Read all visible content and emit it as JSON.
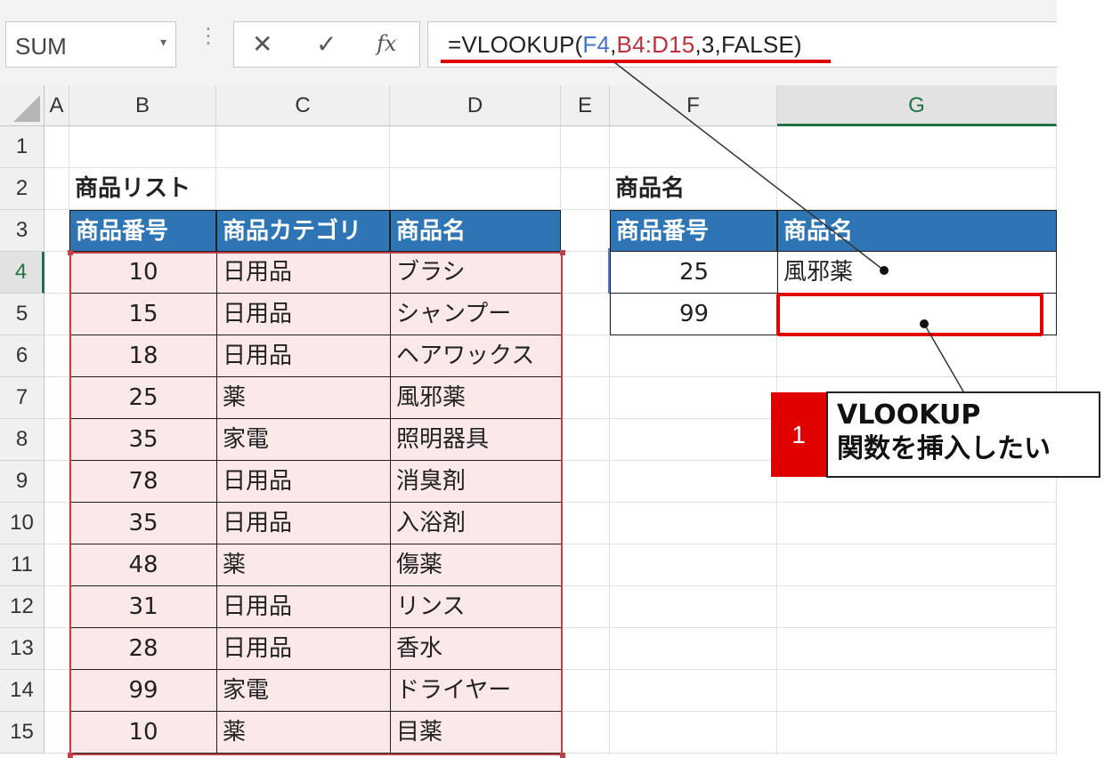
{
  "formula_bar": {
    "name_box": "SUM",
    "name_box_arrow": "▾",
    "separator": "⋮",
    "cancel_icon": "✕",
    "enter_icon": "✓",
    "fx_label": "fx",
    "formula": {
      "prefix": "=VLOOKUP(",
      "ref1": "F4",
      "comma1": ",",
      "ref2": "B4:D15",
      "suffix": ",3,FALSE)"
    },
    "colors": {
      "ref1": "#4472c4",
      "ref2": "#c0303a"
    }
  },
  "columns": [
    "A",
    "B",
    "C",
    "D",
    "E",
    "F",
    "G"
  ],
  "selected_column": "G",
  "rows": [
    "1",
    "2",
    "3",
    "4",
    "5",
    "6",
    "7",
    "8",
    "9",
    "10",
    "11",
    "12",
    "13",
    "14",
    "15"
  ],
  "selected_row": "4",
  "product_list": {
    "title": "商品リスト",
    "headers": [
      "商品番号",
      "商品カテゴリ",
      "商品名"
    ],
    "rows": [
      [
        "10",
        "日用品",
        "ブラシ"
      ],
      [
        "15",
        "日用品",
        "シャンプー"
      ],
      [
        "18",
        "日用品",
        "ヘアワックス"
      ],
      [
        "25",
        "薬",
        "風邪薬"
      ],
      [
        "35",
        "家電",
        "照明器具"
      ],
      [
        "78",
        "日用品",
        "消臭剤"
      ],
      [
        "35",
        "日用品",
        "入浴剤"
      ],
      [
        "48",
        "薬",
        "傷薬"
      ],
      [
        "31",
        "日用品",
        "リンス"
      ],
      [
        "28",
        "日用品",
        "香水"
      ],
      [
        "99",
        "家電",
        "ドライヤー"
      ],
      [
        "10",
        "薬",
        "目薬"
      ]
    ]
  },
  "lookup_table": {
    "title": "商品名",
    "headers": [
      "商品番号",
      "商品名"
    ],
    "rows": [
      [
        "25",
        "風邪薬"
      ],
      [
        "99",
        ""
      ]
    ]
  },
  "annotation": {
    "number": "1",
    "text": "VLOOKUP\n関数を挿入したい",
    "accent": "#e00000"
  },
  "colors": {
    "header_fill": "#2e75b6",
    "range_fill": "#fbe9ea",
    "selection_green": "#217346"
  }
}
